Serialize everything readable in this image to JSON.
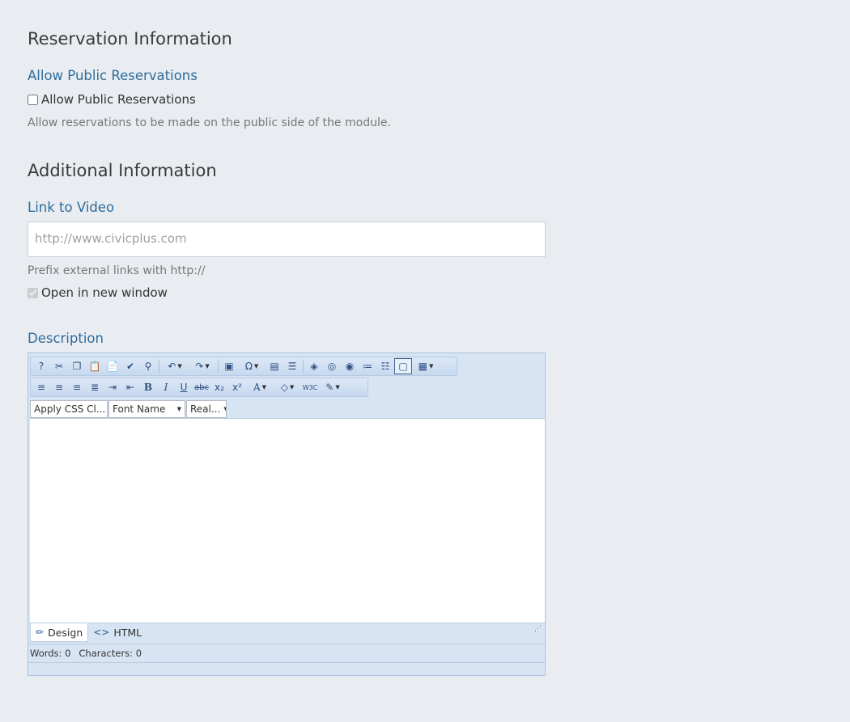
{
  "sections": {
    "reservation": {
      "title": "Reservation Information",
      "field_label": "Allow Public Reservations",
      "checkbox_label": "Allow Public Reservations",
      "help": "Allow reservations to be made on the public side of the module."
    },
    "additional": {
      "title": "Additional Information",
      "link_label": "Link to Video",
      "link_placeholder": "http://www.civicplus.com",
      "link_help": "Prefix external links with http://",
      "new_window_label": "Open in new window",
      "description_label": "Description"
    }
  },
  "editor": {
    "css_class_select": "Apply CSS Cl...",
    "font_name_select": "Font Name",
    "font_size_select": "Real...",
    "mode_design": "Design",
    "mode_html": "HTML",
    "words_label": "Words: 0",
    "chars_label": "Characters: 0",
    "toolbar1": [
      "help-icon",
      "cut-icon",
      "copy-icon",
      "paste-icon",
      "paste-word-icon",
      "spellcheck-icon",
      "find-icon",
      "undo-icon",
      "redo-icon",
      "image-icon",
      "symbol-icon",
      "template-icon",
      "paragraph-icon",
      "media-icon",
      "link-icon",
      "unlink-icon",
      "ordered-list-icon",
      "unordered-list-icon",
      "toggle-border-icon",
      "table-icon"
    ],
    "toolbar2": [
      "align-left-icon",
      "align-center-icon",
      "align-right-icon",
      "justify-icon",
      "indent-icon",
      "outdent-icon",
      "bold-icon",
      "italic-icon",
      "underline-icon",
      "strikethrough-icon",
      "subscript-icon",
      "superscript-icon",
      "font-color-icon",
      "back-color-icon",
      "w3c-icon",
      "format-stripper-icon"
    ]
  },
  "colors": {
    "background": "#e9edf1",
    "label_blue": "#2e6c9c",
    "editor_frame": "#d7e4f3"
  }
}
